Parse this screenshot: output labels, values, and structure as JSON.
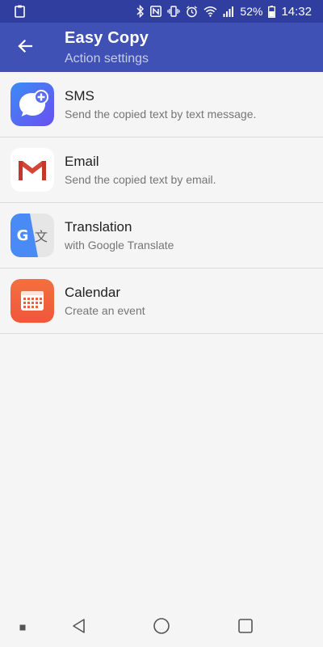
{
  "status_bar": {
    "battery_percent": "52%",
    "time": "14:32",
    "icons": [
      "clipboard-icon",
      "bluetooth-icon",
      "nfc-icon",
      "vibrate-icon",
      "alarm-icon",
      "wifi-icon",
      "signal-icon",
      "battery-icon"
    ]
  },
  "app_bar": {
    "title": "Easy Copy",
    "subtitle": "Action settings",
    "back_icon": "arrow-back-icon",
    "color": "#3f51b5"
  },
  "items": [
    {
      "title": "SMS",
      "description": "Send the copied text by text message.",
      "icon": "sms-icon"
    },
    {
      "title": "Email",
      "description": "Send the copied text by email.",
      "icon": "gmail-icon"
    },
    {
      "title": "Translation",
      "description": "with Google Translate",
      "icon": "google-translate-icon"
    },
    {
      "title": "Calendar",
      "description": "Create an event",
      "icon": "calendar-icon"
    }
  ],
  "nav_bar": {
    "icons": [
      "dot-icon",
      "back-triangle-icon",
      "home-circle-icon",
      "recents-square-icon"
    ]
  }
}
